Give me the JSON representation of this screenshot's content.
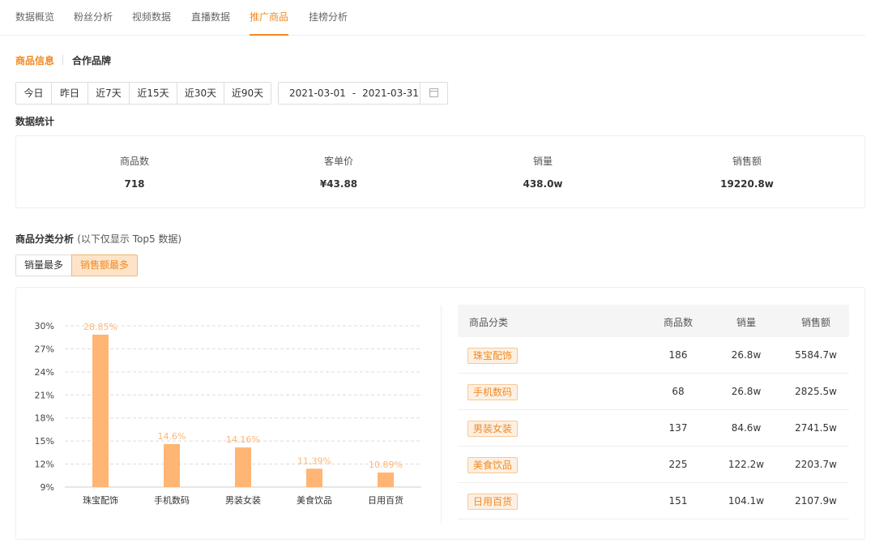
{
  "top_tabs": [
    {
      "label": "数据概览",
      "active": false
    },
    {
      "label": "粉丝分析",
      "active": false
    },
    {
      "label": "视频数据",
      "active": false
    },
    {
      "label": "直播数据",
      "active": false
    },
    {
      "label": "推广商品",
      "active": true
    },
    {
      "label": "挂榜分析",
      "active": false
    }
  ],
  "sub_tabs": [
    {
      "label": "商品信息",
      "active": true
    },
    {
      "label": "合作品牌",
      "active": false
    }
  ],
  "date_ranges": [
    "今日",
    "昨日",
    "近7天",
    "近15天",
    "近30天",
    "近90天"
  ],
  "date_picker": {
    "start": "2021-03-01",
    "separator": "-",
    "end": "2021-03-31",
    "icon": "calendar-icon"
  },
  "stats_title": "数据统计",
  "stats": [
    {
      "label": "商品数",
      "value": "718"
    },
    {
      "label": "客单价",
      "value": "¥43.88"
    },
    {
      "label": "销量",
      "value": "438.0w"
    },
    {
      "label": "销售额",
      "value": "19220.8w"
    }
  ],
  "analysis": {
    "title": "商品分类分析",
    "note": "(以下仅显示 Top5 数据)",
    "sort_options": [
      {
        "label": "销量最多",
        "active": false
      },
      {
        "label": "销售额最多",
        "active": true
      }
    ]
  },
  "chart_data": {
    "type": "bar",
    "categories": [
      "珠宝配饰",
      "手机数码",
      "男装女装",
      "美食饮品",
      "日用百货"
    ],
    "values": [
      28.85,
      14.6,
      14.16,
      11.39,
      10.89
    ],
    "data_labels": [
      "28.85%",
      "14.6%",
      "14.16%",
      "11.39%",
      "10.89%"
    ],
    "y_ticks": [
      "9%",
      "12%",
      "15%",
      "18%",
      "21%",
      "24%",
      "27%",
      "30%"
    ],
    "ylim": [
      9,
      30
    ],
    "grid": true,
    "bar_color": "#ffb574",
    "label_color": "#ffb574"
  },
  "table": {
    "headers": [
      "商品分类",
      "商品数",
      "销量",
      "销售额"
    ],
    "rows": [
      [
        "珠宝配饰",
        "186",
        "26.8w",
        "5584.7w"
      ],
      [
        "手机数码",
        "68",
        "26.8w",
        "2825.5w"
      ],
      [
        "男装女装",
        "137",
        "84.6w",
        "2741.5w"
      ],
      [
        "美食饮品",
        "225",
        "122.2w",
        "2203.7w"
      ],
      [
        "日用百货",
        "151",
        "104.1w",
        "2107.9w"
      ]
    ]
  },
  "colors": {
    "accent": "#f08a24",
    "tag_bg": "#fdf0e2",
    "border": "#eeeeee"
  }
}
